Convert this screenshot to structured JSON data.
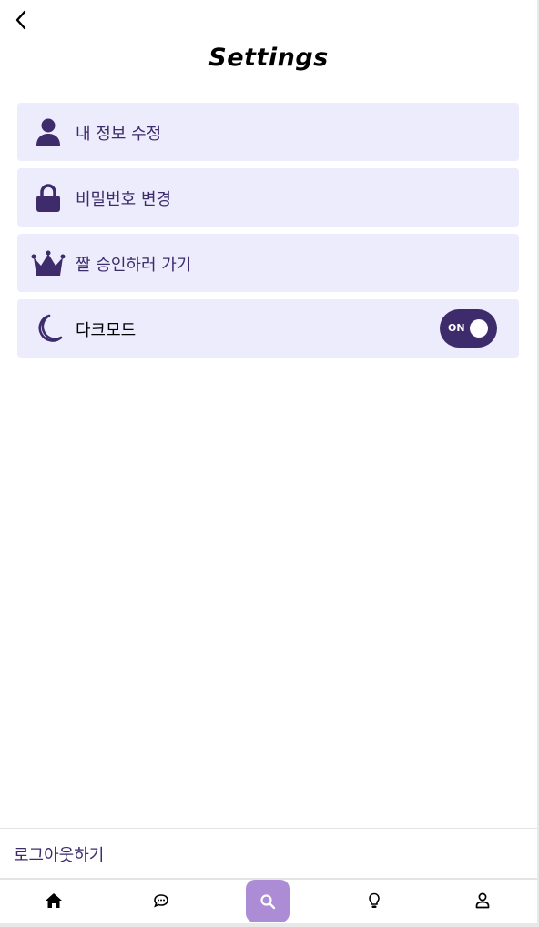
{
  "header": {
    "title": "Settings",
    "back_icon": "chevron-left-icon"
  },
  "settings": {
    "items": [
      {
        "label": "내 정보 수정",
        "icon": "user-icon"
      },
      {
        "label": "비밀번호 변경",
        "icon": "lock-icon"
      },
      {
        "label": "짤 승인하러 가기",
        "icon": "crown-icon"
      },
      {
        "label": "다크모드",
        "icon": "moon-icon",
        "toggle": {
          "label": "ON",
          "on": true
        }
      }
    ]
  },
  "logout": {
    "label": "로그아웃하기"
  },
  "bottom_nav": {
    "items": [
      {
        "icon": "home-icon"
      },
      {
        "icon": "chat-icon"
      },
      {
        "icon": "search-icon",
        "active": true
      },
      {
        "icon": "lightbulb-icon"
      },
      {
        "icon": "user-outline-icon"
      }
    ]
  },
  "colors": {
    "accent": "#3d2b6b",
    "item_bg": "#ececfd",
    "nav_active": "#ab8cd5"
  }
}
